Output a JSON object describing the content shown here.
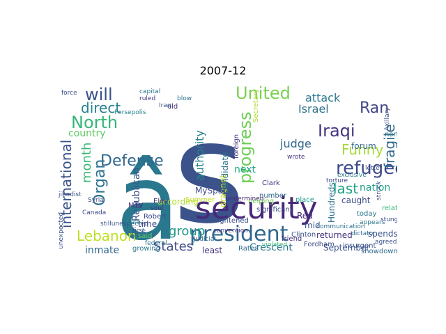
{
  "figure": {
    "title": "2007-12"
  },
  "word_cloud": {
    "palette": [
      "#440154",
      "#46337e",
      "#365c8d",
      "#277f8e",
      "#1fa187",
      "#4ac16d",
      "#a0da39",
      "#fde725"
    ],
    "words": [
      {
        "text": "s",
        "color": "#3b528b"
      },
      {
        "text": "â",
        "color": "#2a788e"
      },
      {
        "text": "security",
        "color": "#482878"
      },
      {
        "text": "president",
        "color": "#31688e"
      },
      {
        "text": "United",
        "color": "#7ad151"
      },
      {
        "text": "refugee",
        "color": "#3e4a89"
      },
      {
        "text": "will",
        "color": "#3b528b"
      },
      {
        "text": "Iraqi",
        "color": "#46337e"
      },
      {
        "text": "Defense",
        "color": "#31688e"
      },
      {
        "text": "North",
        "color": "#35b779"
      },
      {
        "text": "Ran",
        "color": "#414487"
      },
      {
        "text": "progress",
        "color": "#6ece58"
      },
      {
        "text": "direct",
        "color": "#26828e"
      },
      {
        "text": "international",
        "color": "#3b528b"
      },
      {
        "text": "Organ",
        "color": "#2c728e"
      },
      {
        "text": "Funny",
        "color": "#a5db36"
      },
      {
        "text": "last",
        "color": "#20a386"
      },
      {
        "text": "Lebanon",
        "color": "#bddf26"
      },
      {
        "text": "fragile",
        "color": "#31688e"
      },
      {
        "text": "group",
        "color": "#1f988b"
      },
      {
        "text": "month",
        "color": "#3aba76"
      },
      {
        "text": "States",
        "color": "#3e4a89"
      },
      {
        "text": "authority",
        "color": "#26828e"
      },
      {
        "text": "attack",
        "color": "#2a788e"
      },
      {
        "text": "Israel",
        "color": "#2c728e"
      },
      {
        "text": "judge",
        "color": "#31688e"
      },
      {
        "text": "country",
        "color": "#5ec962"
      },
      {
        "text": "nation",
        "color": "#1fa187"
      },
      {
        "text": "next",
        "color": "#22a785"
      },
      {
        "text": "Republican",
        "color": "#3b528b"
      },
      {
        "text": "inmate",
        "color": "#31688e"
      },
      {
        "text": "Crescent",
        "color": "#2a788e"
      },
      {
        "text": "according",
        "color": "#addc30"
      },
      {
        "text": "forum",
        "color": "#31688e"
      },
      {
        "text": "returned",
        "color": "#46337e"
      },
      {
        "text": "Hundreds",
        "color": "#2c728e"
      },
      {
        "text": "September",
        "color": "#3b528b"
      },
      {
        "text": "caught",
        "color": "#3e4a89"
      },
      {
        "text": "spends",
        "color": "#3b528b"
      },
      {
        "text": "showdown",
        "color": "#31688e"
      },
      {
        "text": "dragnet",
        "color": "#c2df23"
      },
      {
        "text": "candidate",
        "color": "#2c728e"
      },
      {
        "text": "foreign",
        "color": "#46337e"
      },
      {
        "text": "MySpace",
        "color": "#3e4a89"
      },
      {
        "text": "policy",
        "color": "#31688e"
      },
      {
        "text": "time",
        "color": "#3e4a89"
      },
      {
        "text": "Red",
        "color": "#482878"
      },
      {
        "text": "mid",
        "color": "#3b528b"
      },
      {
        "text": "least",
        "color": "#46337e"
      },
      {
        "text": "Rates",
        "color": "#31688e"
      },
      {
        "text": "helping",
        "color": "#6ece58"
      },
      {
        "text": "heightened",
        "color": "#3b528b"
      },
      {
        "text": "growing",
        "color": "#2a788e"
      },
      {
        "text": "said",
        "color": "#5ec962"
      },
      {
        "text": "Robert",
        "color": "#3e4a89"
      },
      {
        "text": "Eley",
        "color": "#46337e"
      },
      {
        "text": "MTV",
        "color": "#482878"
      },
      {
        "text": "Summer",
        "color": "#c2df23"
      },
      {
        "text": "Clinton",
        "color": "#3b528b"
      },
      {
        "text": "friend",
        "color": "#46337e"
      },
      {
        "text": "place",
        "color": "#1f988b"
      },
      {
        "text": "today",
        "color": "#2a788e"
      },
      {
        "text": "insurgent",
        "color": "#3b528b"
      },
      {
        "text": "related",
        "color": "#35b779"
      },
      {
        "text": "northern",
        "color": "#2a788e"
      },
      {
        "text": "Fordham",
        "color": "#3e4a89"
      },
      {
        "text": "Clark",
        "color": "#46337e"
      },
      {
        "text": "number",
        "color": "#31688e"
      },
      {
        "text": "significant",
        "color": "#3e4a89"
      },
      {
        "text": "Secretary",
        "color": "#addc30"
      },
      {
        "text": "old",
        "color": "#46337e"
      },
      {
        "text": "force",
        "color": "#3b528b"
      },
      {
        "text": "first",
        "color": "#3b528b"
      },
      {
        "text": "federal",
        "color": "#2c728e"
      },
      {
        "text": "jihadist",
        "color": "#3b528b"
      },
      {
        "text": "Axillary",
        "color": "#3b528b"
      },
      {
        "text": "struck",
        "color": "#3e4a89"
      },
      {
        "text": "stung",
        "color": "#3e4a89"
      },
      {
        "text": "exclusive",
        "color": "#2a788e"
      },
      {
        "text": "torture",
        "color": "#3e4a89"
      },
      {
        "text": "letter",
        "color": "#3b528b"
      },
      {
        "text": "dictator",
        "color": "#31688e"
      },
      {
        "text": "convention",
        "color": "#46337e"
      },
      {
        "text": "communication",
        "color": "#2c728e"
      },
      {
        "text": "judicial",
        "color": "#31688e"
      },
      {
        "text": "Late",
        "color": "#1f988b"
      },
      {
        "text": "Canada",
        "color": "#3e4a89"
      },
      {
        "text": "Persepolis",
        "color": "#26828e"
      },
      {
        "text": "ruled",
        "color": "#46337e"
      },
      {
        "text": "capital",
        "color": "#2c728e"
      },
      {
        "text": "Syria",
        "color": "#3e4a89"
      },
      {
        "text": "unexpected",
        "color": "#3b528b"
      },
      {
        "text": "undermined",
        "color": "#482878"
      },
      {
        "text": "appears",
        "color": "#2a788e"
      },
      {
        "text": "wrote",
        "color": "#46337e"
      },
      {
        "text": "violated",
        "color": "#35b779"
      },
      {
        "text": "agreed",
        "color": "#3b528b"
      },
      {
        "text": "stillunexpected",
        "color": "#3b528b"
      },
      {
        "text": "blow",
        "color": "#2c728e"
      },
      {
        "text": "soul",
        "color": "#46337e"
      },
      {
        "text": "Iraq",
        "color": "#3b528b"
      }
    ]
  }
}
